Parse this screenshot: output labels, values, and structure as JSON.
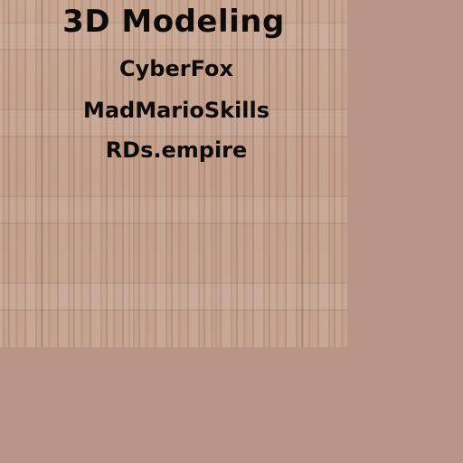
{
  "title": "3D Modeling",
  "credits": [
    "CyberFox",
    "MadMarioSkills",
    "RDs.empire"
  ],
  "colors": {
    "background": "#b99585",
    "wood": "#c09c88",
    "text": "#0e0a08"
  }
}
